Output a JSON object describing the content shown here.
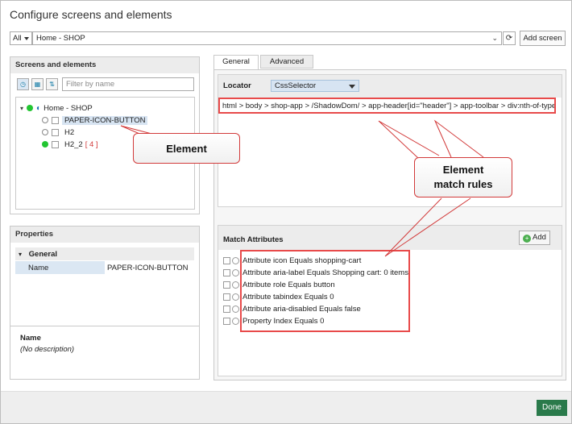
{
  "dialog": {
    "title": "Configure screens and elements"
  },
  "topbar": {
    "scope": "All",
    "screen": "Home - SHOP",
    "add_screen_label": "Add screen"
  },
  "screens_panel": {
    "title": "Screens and elements",
    "filter_placeholder": "Filter by name",
    "tree": {
      "root": "Home - SHOP",
      "items": [
        {
          "label": "PAPER-ICON-BUTTON",
          "count": ""
        },
        {
          "label": "H2",
          "count": ""
        },
        {
          "label": "H2_2",
          "count": "[ 4 ]"
        }
      ]
    }
  },
  "properties_panel": {
    "title": "Properties",
    "group": "General",
    "rows": [
      {
        "key": "Name",
        "value": "PAPER-ICON-BUTTON"
      }
    ],
    "desc_title": "Name",
    "desc_text": "(No description)"
  },
  "tabs": [
    {
      "label": "General"
    },
    {
      "label": "Advanced"
    }
  ],
  "locator": {
    "label": "Locator",
    "type": "CssSelector",
    "value": "html > body > shop-app > /ShadowDom/ > app-header[id=\"header\"] > app-toolbar > div:nth-of-type("
  },
  "match_attributes": {
    "title": "Match Attributes",
    "add_label": "Add",
    "items": [
      "Attribute icon Equals shopping-cart",
      "Attribute aria-label Equals Shopping cart: 0 items",
      "Attribute role Equals button",
      "Attribute tabindex Equals 0",
      "Attribute aria-disabled Equals false",
      "Property Index Equals 0"
    ]
  },
  "callouts": {
    "element": "Element",
    "rules_line1": "Element",
    "rules_line2": "match rules"
  },
  "footer": {
    "done_label": "Done"
  },
  "colors": {
    "accent": "#2a7a4b",
    "highlight": "#e84a4a",
    "status_green": "#22c531",
    "selection": "#d7e4f2"
  }
}
